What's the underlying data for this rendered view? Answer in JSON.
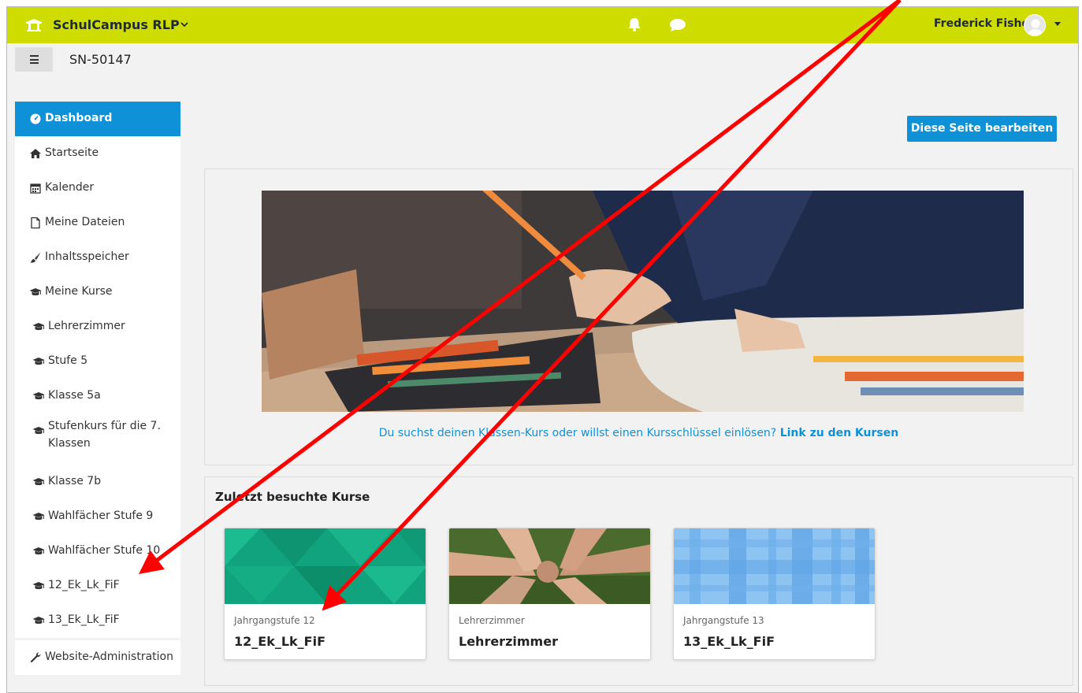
{
  "navbar": {
    "title": "SchulCampus RLP",
    "user_name": "Frederick Fisher",
    "bar_color": "#cfdc00"
  },
  "page": {
    "course_code": "SN-50147",
    "edit_button": "Diese Seite bearbeiten"
  },
  "sidebar": {
    "items": [
      {
        "label": "Dashboard",
        "icon": "dashboard-icon"
      },
      {
        "label": "Startseite",
        "icon": "home-icon"
      },
      {
        "label": "Kalender",
        "icon": "calendar-icon"
      },
      {
        "label": "Meine Dateien",
        "icon": "file-icon"
      },
      {
        "label": "Inhaltsspeicher",
        "icon": "brush-icon"
      },
      {
        "label": "Meine Kurse",
        "icon": "graduation-cap-icon"
      },
      {
        "label": "Lehrerzimmer",
        "icon": "graduation-cap-icon"
      },
      {
        "label": "Stufe 5",
        "icon": "graduation-cap-icon"
      },
      {
        "label": "Klasse 5a",
        "icon": "graduation-cap-icon"
      },
      {
        "label": "Stufenkurs für die 7. Klassen",
        "icon": "graduation-cap-icon"
      },
      {
        "label": "Klasse 7b",
        "icon": "graduation-cap-icon"
      },
      {
        "label": "Wahlfächer Stufe 9",
        "icon": "graduation-cap-icon"
      },
      {
        "label": "Wahlfächer Stufe 10",
        "icon": "graduation-cap-icon"
      },
      {
        "label": "12_Ek_Lk_FiF",
        "icon": "graduation-cap-icon"
      },
      {
        "label": "13_Ek_Lk_FiF",
        "icon": "graduation-cap-icon"
      }
    ],
    "admin": {
      "label": "Website-Administration",
      "icon": "wrench-icon"
    }
  },
  "hero": {
    "text": "Du suchst deinen Klassen-Kurs oder willst einen Kursschlüssel einlösen?",
    "link": "Link zu den Kursen"
  },
  "recent": {
    "title": "Zuletzt besuchte Kurse",
    "courses": [
      {
        "category": "Jahrgangstufe 12",
        "name": "12_Ek_Lk_FiF"
      },
      {
        "category": "Lehrerzimmer",
        "name": "Lehrerzimmer"
      },
      {
        "category": "Jahrgangstufe 13",
        "name": "13_Ek_Lk_FiF"
      }
    ]
  },
  "colors": {
    "accent": "#0f91d8",
    "annotation": "#ff0000"
  }
}
